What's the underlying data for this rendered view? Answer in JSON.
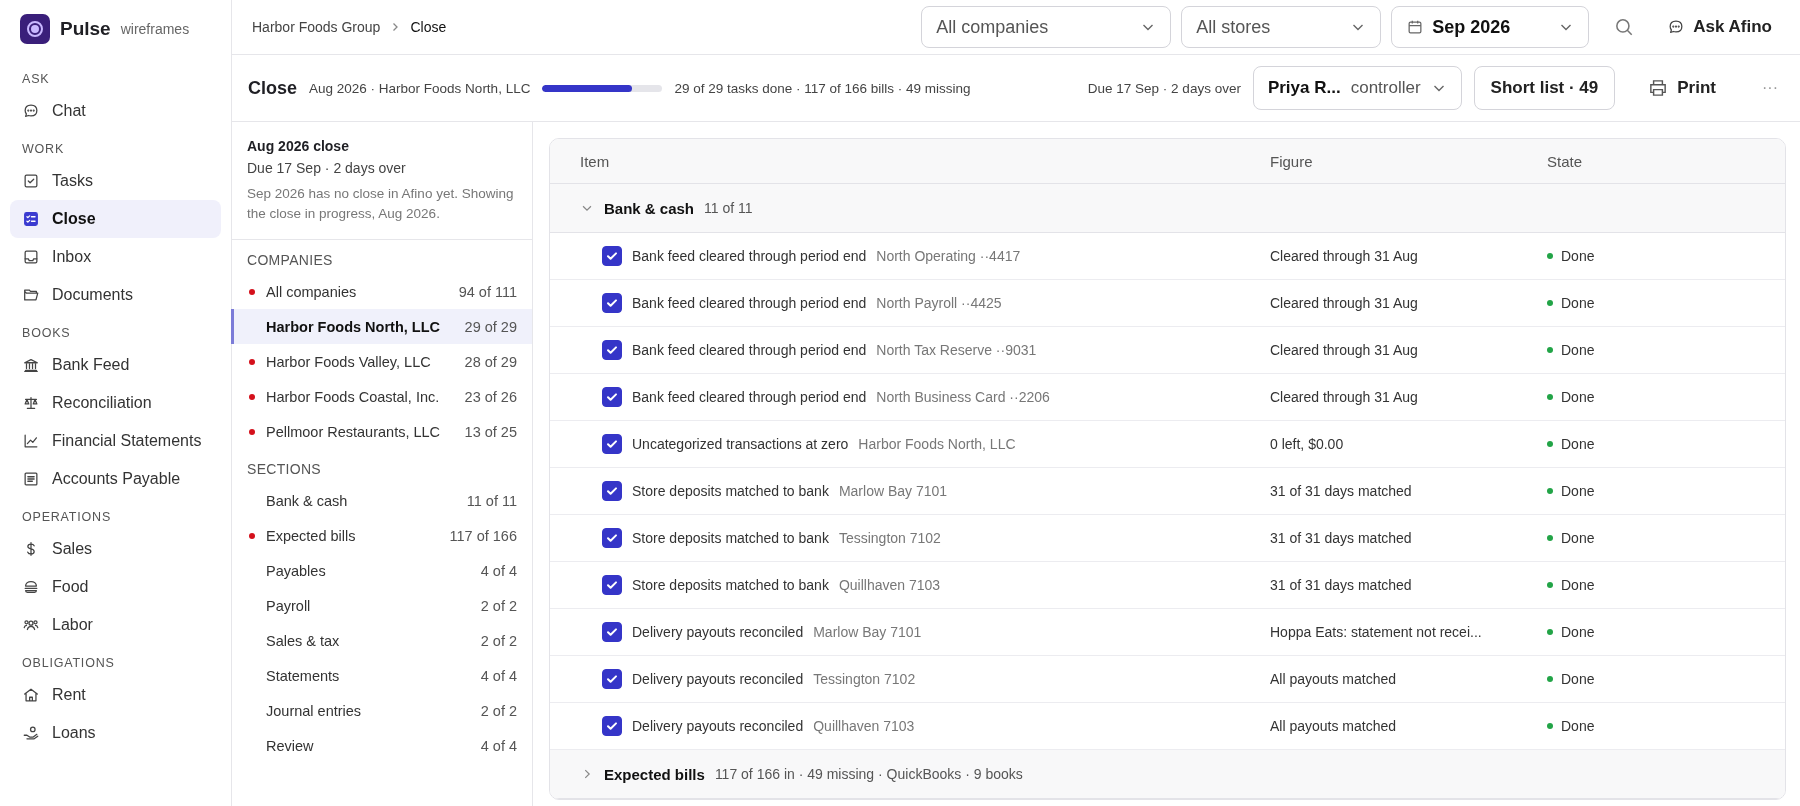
{
  "app": {
    "name": "Pulse",
    "tag": "wireframes"
  },
  "nav": [
    {
      "heading": "ASK",
      "items": [
        {
          "label": "Chat",
          "selected": false
        }
      ]
    },
    {
      "heading": "WORK",
      "items": [
        {
          "label": "Tasks",
          "selected": false
        },
        {
          "label": "Close",
          "selected": true
        },
        {
          "label": "Inbox",
          "selected": false
        },
        {
          "label": "Documents",
          "selected": false
        }
      ]
    },
    {
      "heading": "BOOKS",
      "items": [
        {
          "label": "Bank Feed",
          "selected": false
        },
        {
          "label": "Reconciliation",
          "selected": false
        },
        {
          "label": "Financial Statements",
          "selected": false
        },
        {
          "label": "Accounts Payable",
          "selected": false
        }
      ]
    },
    {
      "heading": "OPERATIONS",
      "items": [
        {
          "label": "Sales",
          "selected": false
        },
        {
          "label": "Food",
          "selected": false
        },
        {
          "label": "Labor",
          "selected": false
        }
      ]
    },
    {
      "heading": "OBLIGATIONS",
      "items": [
        {
          "label": "Rent",
          "selected": false
        },
        {
          "label": "Loans",
          "selected": false
        }
      ]
    }
  ],
  "breadcrumb": [
    "Harbor Foods Group",
    "Close"
  ],
  "filters": {
    "company": "All companies",
    "store": "All stores",
    "period": "Sep 2026"
  },
  "ask": "Ask Afino",
  "header": {
    "title": "Close",
    "context": "Aug 2026 · Harbor Foods North, LLC",
    "level": 0.75,
    "progress": "29 of 29 tasks done · 117 of 166 bills · 49 missing",
    "due": "Due 17 Sep · 2 days over",
    "owner": "Priya R...",
    "role": "controller",
    "shortlist": "Short list · 49",
    "print": "Print",
    "more": "···"
  },
  "panel": {
    "title": "Aug 2026 close",
    "due": "Due 17 Sep · 2 days over",
    "note": "Sep 2026 has no close in Afino yet. Showing the close in progress, Aug 2026.",
    "companies_heading": "COMPANIES",
    "companies": [
      {
        "name": "All companies",
        "count": "94 of 111",
        "flagged": true,
        "selected": false
      },
      {
        "name": "Harbor Foods North, LLC",
        "count": "29 of 29",
        "flagged": false,
        "selected": true
      },
      {
        "name": "Harbor Foods Valley, LLC",
        "count": "28 of 29",
        "flagged": true,
        "selected": false
      },
      {
        "name": "Harbor Foods Coastal, Inc.",
        "count": "23 of 26",
        "flagged": true,
        "selected": false
      },
      {
        "name": "Pellmoor Restaurants, LLC",
        "count": "13 of 25",
        "flagged": true,
        "selected": false
      }
    ],
    "sections_heading": "SECTIONS",
    "sections": [
      {
        "name": "Bank & cash",
        "count": "11 of 11",
        "flagged": false,
        "selected": false
      },
      {
        "name": "Expected bills",
        "count": "117 of 166",
        "flagged": true,
        "selected": false
      },
      {
        "name": "Payables",
        "count": "4 of 4",
        "flagged": false,
        "selected": false
      },
      {
        "name": "Payroll",
        "count": "2 of 2",
        "flagged": false,
        "selected": false
      },
      {
        "name": "Sales & tax",
        "count": "2 of 2",
        "flagged": false,
        "selected": false
      },
      {
        "name": "Statements",
        "count": "4 of 4",
        "flagged": false,
        "selected": false
      },
      {
        "name": "Journal entries",
        "count": "2 of 2",
        "flagged": false,
        "selected": false
      },
      {
        "name": "Review",
        "count": "4 of 4",
        "flagged": false,
        "selected": false
      }
    ]
  },
  "table": {
    "columns": [
      "Item",
      "Figure",
      "State"
    ],
    "groups": [
      {
        "title": "Bank & cash",
        "meta": "11 of 11",
        "expanded": true,
        "rows": [
          {
            "checked": true,
            "item": "Bank feed cleared through period end",
            "detail": "North Operating ··4417",
            "figure": "Cleared through 31 Aug",
            "state": "Done",
            "color": "#22a447"
          },
          {
            "checked": true,
            "item": "Bank feed cleared through period end",
            "detail": "North Payroll ··4425",
            "figure": "Cleared through 31 Aug",
            "state": "Done",
            "color": "#22a447"
          },
          {
            "checked": true,
            "item": "Bank feed cleared through period end",
            "detail": "North Tax Reserve ··9031",
            "figure": "Cleared through 31 Aug",
            "state": "Done",
            "color": "#22a447"
          },
          {
            "checked": true,
            "item": "Bank feed cleared through period end",
            "detail": "North Business Card ··2206",
            "figure": "Cleared through 31 Aug",
            "state": "Done",
            "color": "#22a447"
          },
          {
            "checked": true,
            "item": "Uncategorized transactions at zero",
            "detail": "Harbor Foods North, LLC",
            "figure": "0 left, $0.00",
            "state": "Done",
            "color": "#22a447"
          },
          {
            "checked": true,
            "item": "Store deposits matched to bank",
            "detail": "Marlow Bay 7101",
            "figure": "31 of 31 days matched",
            "state": "Done",
            "color": "#22a447"
          },
          {
            "checked": true,
            "item": "Store deposits matched to bank",
            "detail": "Tessington 7102",
            "figure": "31 of 31 days matched",
            "state": "Done",
            "color": "#22a447"
          },
          {
            "checked": true,
            "item": "Store deposits matched to bank",
            "detail": "Quillhaven 7103",
            "figure": "31 of 31 days matched",
            "state": "Done",
            "color": "#22a447"
          },
          {
            "checked": true,
            "item": "Delivery payouts reconciled",
            "detail": "Marlow Bay 7101",
            "figure": "Hoppa Eats: statement not recei...",
            "state": "Done",
            "color": "#22a447"
          },
          {
            "checked": true,
            "item": "Delivery payouts reconciled",
            "detail": "Tessington 7102",
            "figure": "All payouts matched",
            "state": "Done",
            "color": "#22a447"
          },
          {
            "checked": true,
            "item": "Delivery payouts reconciled",
            "detail": "Quillhaven 7103",
            "figure": "All payouts matched",
            "state": "Done",
            "color": "#22a447"
          }
        ]
      },
      {
        "title": "Expected bills",
        "meta": "117 of 166 in · 49 missing · QuickBooks · 9 books",
        "expanded": false
      }
    ]
  }
}
